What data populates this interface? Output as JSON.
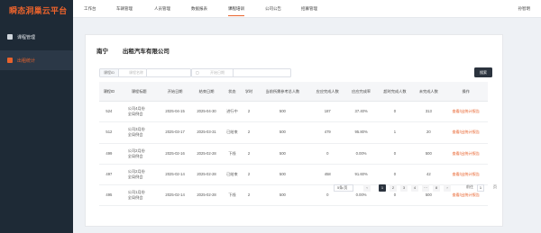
{
  "app": {
    "brand": "瞬态洞巢云平台"
  },
  "sidebar": {
    "items": [
      {
        "label": "课程管理",
        "icon": "course-icon",
        "active": false
      },
      {
        "label": "出租统计",
        "icon": "stats-icon",
        "active": true
      }
    ]
  },
  "topnav": {
    "items": [
      {
        "label": "工作台"
      },
      {
        "label": "车辆管理"
      },
      {
        "label": "人员管理"
      },
      {
        "label": "数据报表"
      },
      {
        "label": "课程培训",
        "active": true
      },
      {
        "label": "公司公告"
      },
      {
        "label": "招募管理"
      }
    ],
    "user": "孙智明"
  },
  "header": {
    "city": "南宁",
    "company": "出租汽车有限公司"
  },
  "filters": {
    "course_id_label": "课程ID",
    "name_placeholder": "课程名称",
    "start_placeholder": "开始日期",
    "range_sep": "至",
    "end_placeholder": "结束日期",
    "search_label": "搜索"
  },
  "table": {
    "columns": [
      "课程ID",
      "课程标题",
      "开始日期",
      "结束日期",
      "状态",
      "学时",
      "当前所需参考总人数",
      "应应完成人数",
      "应应完成率",
      "超时完成人数",
      "未完成人数",
      "操作"
    ],
    "rows": [
      {
        "id": "524",
        "title": "公司4月份\n全局例会",
        "start": "2025-04-15",
        "end": "2025-04-30",
        "status": "进行中",
        "hours": "2",
        "total": "500",
        "done": "187",
        "rate": "37.40%",
        "late": "0",
        "undone": "313",
        "op": "查看/出统计报告"
      },
      {
        "id": "512",
        "title": "公司3月份\n全局例会",
        "start": "2025-03-17",
        "end": "2025-03-31",
        "status": "已结束",
        "hours": "2",
        "total": "500",
        "done": "479",
        "rate": "95.80%",
        "late": "1",
        "undone": "20",
        "op": "查看/出统计报告"
      },
      {
        "id": "499",
        "title": "公司2月份\n全局例会",
        "start": "2025-02-16",
        "end": "2025-02-28",
        "status": "下线",
        "hours": "2",
        "total": "500",
        "done": "0",
        "rate": "0.00%",
        "late": "0",
        "undone": "500",
        "op": "查看/出统计报告"
      },
      {
        "id": "497",
        "title": "公司2月份\n全局例会",
        "start": "2025-02-14",
        "end": "2025-02-28",
        "status": "已结束",
        "hours": "2",
        "total": "500",
        "done": "458",
        "rate": "91.60%",
        "late": "0",
        "undone": "42",
        "op": "查看/出统计报告"
      },
      {
        "id": "495",
        "title": "公司1月份\n全局例会",
        "start": "2025-02-14",
        "end": "2025-02-28",
        "status": "下线",
        "hours": "2",
        "total": "500",
        "done": "0",
        "rate": "0.00%",
        "late": "0",
        "undone": "500",
        "op": "查看/出统计报告"
      }
    ]
  },
  "pagination": {
    "page_size": "5条/页",
    "prev": "‹",
    "pages": [
      "1",
      "2",
      "3",
      "4"
    ],
    "ellipsis": "···",
    "last": "8",
    "next": "›",
    "current": "1",
    "goto_label": "前往",
    "goto_value": "1",
    "goto_unit": "页"
  },
  "colors": {
    "accent": "#e8622c",
    "sidebar_bg": "#1e2a36",
    "dark_button": "#2b333e"
  }
}
